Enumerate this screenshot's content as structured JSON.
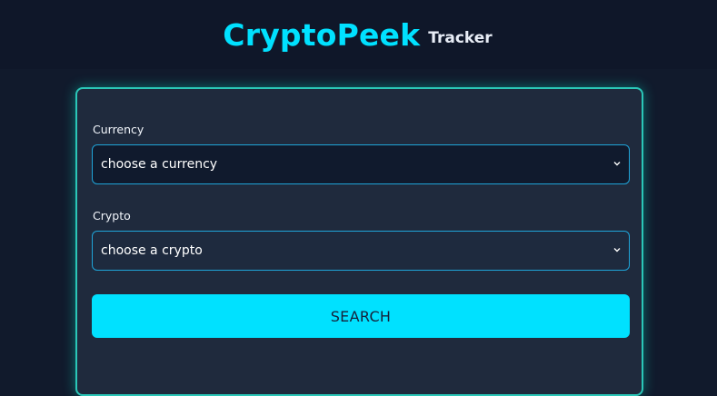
{
  "header": {
    "title": "CryptoPeek",
    "subtitle": "Tracker"
  },
  "form": {
    "currency": {
      "label": "Currency",
      "selected": "choose a currency"
    },
    "crypto": {
      "label": "Crypto",
      "selected": "choose a crypto"
    },
    "search_label": "SEARCH"
  },
  "colors": {
    "accent": "#00e1ff",
    "card_border": "#2bc7b8",
    "background": "#111a2c"
  },
  "icons": {
    "select_arrow": "chevron-down-icon"
  }
}
